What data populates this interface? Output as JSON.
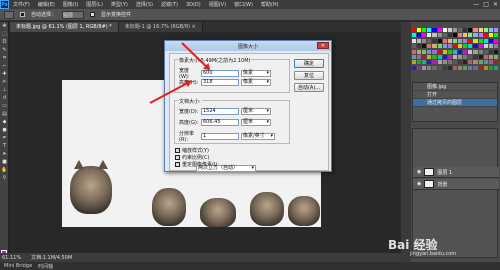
{
  "menubar": {
    "logo": "Ps",
    "items": [
      "文件(F)",
      "编辑(E)",
      "图像(I)",
      "图层(L)",
      "类型(Y)",
      "选择(S)",
      "滤镜(T)",
      "3D(D)",
      "视图(V)",
      "窗口(W)",
      "帮助(H)"
    ],
    "window_buttons": [
      "—",
      "□",
      "✕"
    ]
  },
  "optionsbar": {
    "auto_select_label": "自动选择：",
    "auto_select_value": "图层",
    "show_transform_label": "显示变换控件"
  },
  "tabs": [
    {
      "label": "未标题.jpg @ 61.1% (图层 1, RGB/8#) *",
      "active": true
    },
    {
      "label": "未标题-1 @ 16.7% (RGB/8) ×",
      "active": false
    }
  ],
  "status": {
    "zoom": "61.11%",
    "doc": "文档:1.1M/4.50M"
  },
  "minibridge": [
    "Mini Bridge",
    "时间轴"
  ],
  "history_panel": {
    "rows": [
      "图像.jpg",
      "打开",
      "通过拷贝的图层"
    ]
  },
  "layers_panel": {
    "rows": [
      "图层 1",
      "背景"
    ]
  },
  "dialog": {
    "title": "图像大小",
    "close": "✕",
    "pixel_dims_label": "像素大小:5.49M(之前为2.10M)",
    "width_label": "宽度(W):",
    "width_value": "600",
    "width_unit": "像素",
    "height_label": "高度(H):",
    "height_value": "318",
    "height_unit": "像素",
    "doc_size_label": "文档大小:",
    "doc_width_label": "宽度(D):",
    "doc_width_value": "1524",
    "doc_width_unit": "厘米",
    "doc_height_label": "高度(G):",
    "doc_height_value": "606.45",
    "doc_height_unit": "厘米",
    "resolution_label": "分辨率(R):",
    "resolution_value": "1",
    "resolution_unit": "像素/英寸",
    "scale_styles_label": "缩放样式(Y)",
    "constrain_label": "约束比例(C)",
    "resample_label": "重定图像像素(I):",
    "resample_value": "两次立方（自动）",
    "ok_label": "确定",
    "reset_label": "复位",
    "auto_label": "自动(A)..."
  },
  "watermark": {
    "text": "Bai 经验",
    "url": "jingyan.baidu.com"
  },
  "colors": {
    "accent": "#e0201d",
    "selection": "#3d6fa3",
    "foreground": "#c819c8"
  }
}
